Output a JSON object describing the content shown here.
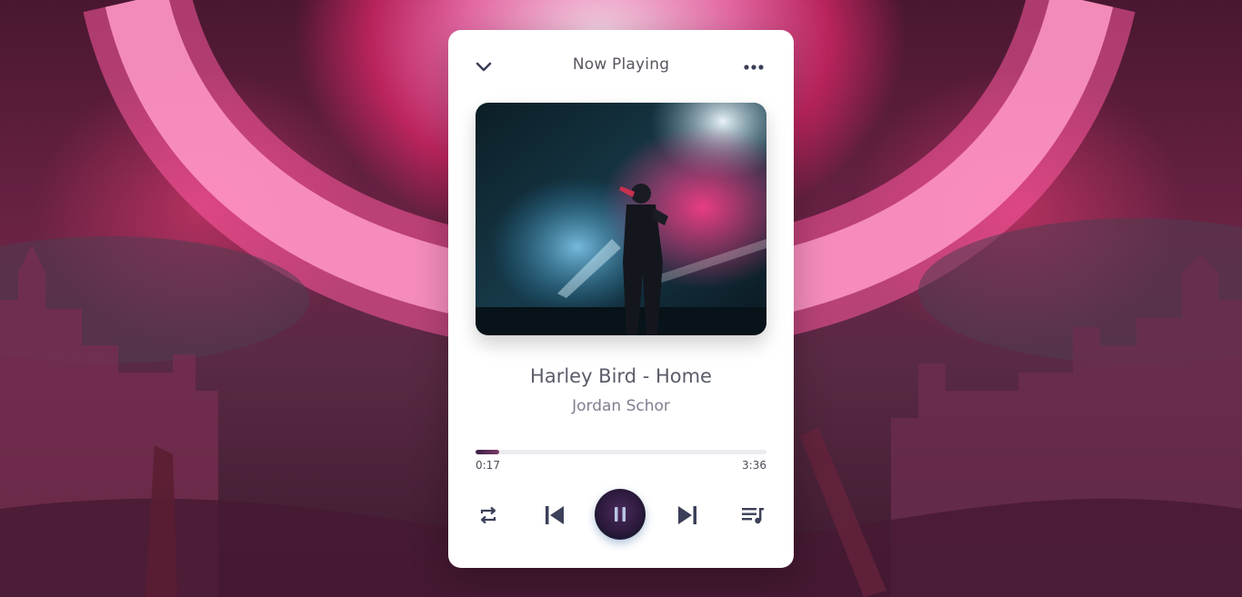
{
  "header": {
    "title": "Now Playing"
  },
  "track": {
    "title": "Harley Bird - Home",
    "artist": "Jordan Schor",
    "current_time": "0:17",
    "total_time": "3:36",
    "progress_fraction": 0.08
  },
  "controls": {
    "state": "playing"
  },
  "icons": {
    "collapse": "chevron-down-icon",
    "more": "more-horizontal-icon",
    "repeat": "repeat-icon",
    "previous": "skip-previous-icon",
    "pause": "pause-icon",
    "next": "skip-next-icon",
    "queue": "queue-music-icon"
  },
  "colors": {
    "accent_dark": "#2d1a3d",
    "accent_ring": "#3a7fbf",
    "text_primary": "#5a5c68",
    "text_secondary": "#7f8091"
  }
}
